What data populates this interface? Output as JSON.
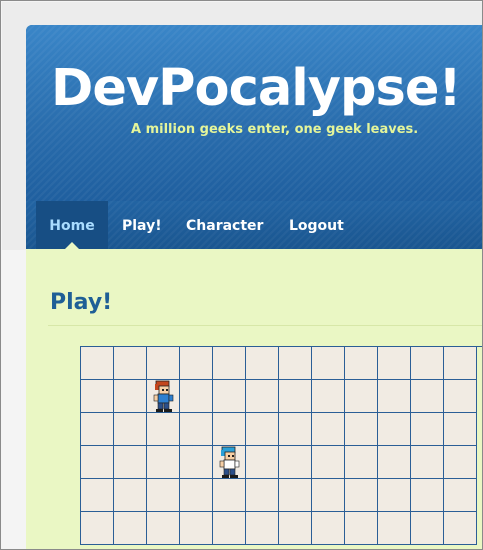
{
  "site": {
    "title": "DevPocalypse!",
    "tagline": "A million geeks enter, one geek leaves."
  },
  "nav": {
    "items": [
      {
        "label": "Home",
        "active": true
      },
      {
        "label": "Play!",
        "active": false
      },
      {
        "label": "Character",
        "active": false
      },
      {
        "label": "Logout",
        "active": false
      }
    ]
  },
  "main": {
    "heading": "Play!"
  },
  "game": {
    "grid": {
      "columns": 12,
      "rows": 6
    },
    "characters": [
      {
        "name": "red-haired-geek",
        "column": 3,
        "row": 2,
        "hair": "#c4461c",
        "shirt": "#2d7fd0"
      },
      {
        "name": "blue-haired-geek",
        "column": 5,
        "row": 4,
        "hair": "#2aa0d8",
        "shirt": "#ffffff"
      }
    ]
  },
  "colors": {
    "header_blue": "#2a6aa8",
    "content_bg": "#eaf7c4",
    "title_text": "#ffffff",
    "tagline_text": "#e4f59a",
    "heading_text": "#1f5f96",
    "grid_line": "#2b5e96",
    "cell_bg": "#f1ebe3"
  }
}
